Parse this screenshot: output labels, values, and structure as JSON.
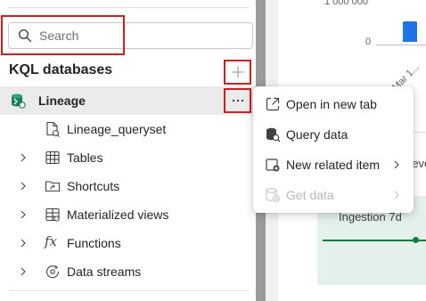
{
  "search": {
    "placeholder": "Search"
  },
  "section": {
    "title": "KQL databases"
  },
  "database": {
    "name": "Lineage"
  },
  "tree": {
    "items": [
      {
        "label": "Lineage_queryset",
        "icon": "queryset-icon",
        "expandable": false
      },
      {
        "label": "Tables",
        "icon": "table-icon",
        "expandable": true
      },
      {
        "label": "Shortcuts",
        "icon": "shortcut-folder-icon",
        "expandable": true
      },
      {
        "label": "Materialized views",
        "icon": "materialized-view-icon",
        "expandable": true
      },
      {
        "label": "Functions",
        "icon": "function-fx-icon",
        "expandable": true
      },
      {
        "label": "Data streams",
        "icon": "data-stream-icon",
        "expandable": true
      }
    ]
  },
  "context_menu": {
    "items": [
      {
        "label": "Open in new tab",
        "icon": "open-new-tab-icon",
        "submenu": false,
        "disabled": false
      },
      {
        "label": "Query data",
        "icon": "query-database-icon",
        "submenu": false,
        "disabled": false
      },
      {
        "label": "New related item",
        "icon": "new-item-icon",
        "submenu": true,
        "disabled": false
      },
      {
        "label": "Get data",
        "icon": "get-data-icon",
        "submenu": true,
        "disabled": true
      }
    ]
  },
  "background": {
    "y_tick_top": "1 000 000",
    "y_tick_zero": "0",
    "x_tick": "Mar 1...",
    "card_text": "reve",
    "ingestion_label": "Ingestion 7d"
  },
  "colors": {
    "highlight": "#cc1f1f",
    "bar": "#1f73e8",
    "ingestion_fill": "#e3f1ea",
    "ingestion_line": "#107c41"
  }
}
